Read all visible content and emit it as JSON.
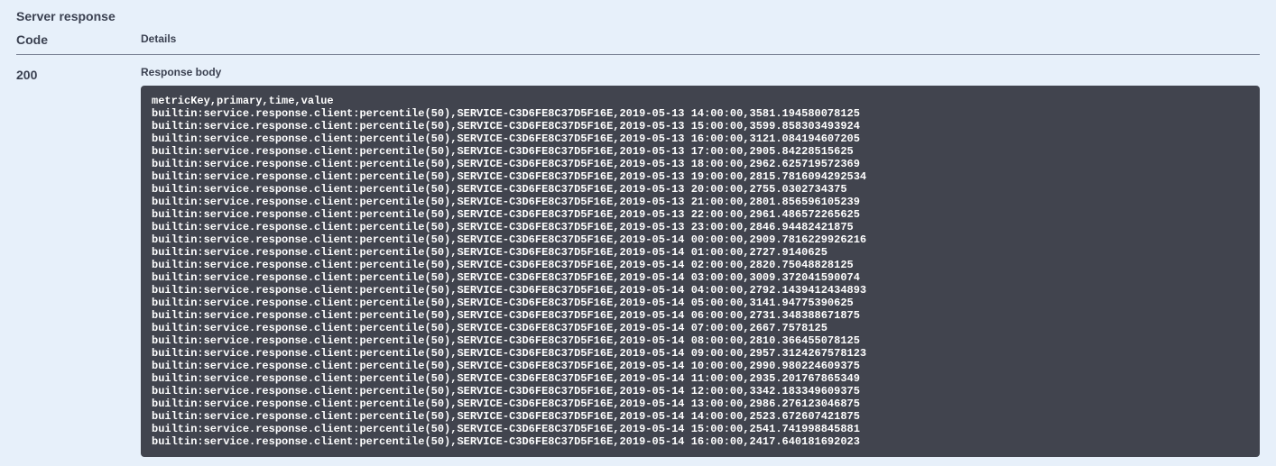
{
  "header": {
    "section_title": "Server response",
    "col_code": "Code",
    "col_details": "Details"
  },
  "row": {
    "code": "200",
    "body_label": "Response body"
  },
  "response": {
    "header_line": "metricKey,primary,time,value",
    "metric_prefix": "builtin:service.response.client:percentile(50),SERVICE-C3D6FE8C37D5F16E,",
    "rows": [
      {
        "time": "2019-05-13 14:00:00",
        "value": "3581.194580078125"
      },
      {
        "time": "2019-05-13 15:00:00",
        "value": "3599.858303493924"
      },
      {
        "time": "2019-05-13 16:00:00",
        "value": "3121.084194607205"
      },
      {
        "time": "2019-05-13 17:00:00",
        "value": "2905.84228515625"
      },
      {
        "time": "2019-05-13 18:00:00",
        "value": "2962.625719572369"
      },
      {
        "time": "2019-05-13 19:00:00",
        "value": "2815.7816094292534"
      },
      {
        "time": "2019-05-13 20:00:00",
        "value": "2755.0302734375"
      },
      {
        "time": "2019-05-13 21:00:00",
        "value": "2801.856596105239"
      },
      {
        "time": "2019-05-13 22:00:00",
        "value": "2961.486572265625"
      },
      {
        "time": "2019-05-13 23:00:00",
        "value": "2846.94482421875"
      },
      {
        "time": "2019-05-14 00:00:00",
        "value": "2909.7816229926216"
      },
      {
        "time": "2019-05-14 01:00:00",
        "value": "2727.9140625"
      },
      {
        "time": "2019-05-14 02:00:00",
        "value": "2820.75048828125"
      },
      {
        "time": "2019-05-14 03:00:00",
        "value": "3009.372041590074"
      },
      {
        "time": "2019-05-14 04:00:00",
        "value": "2792.1439412434893"
      },
      {
        "time": "2019-05-14 05:00:00",
        "value": "3141.94775390625"
      },
      {
        "time": "2019-05-14 06:00:00",
        "value": "2731.348388671875"
      },
      {
        "time": "2019-05-14 07:00:00",
        "value": "2667.7578125"
      },
      {
        "time": "2019-05-14 08:00:00",
        "value": "2810.366455078125"
      },
      {
        "time": "2019-05-14 09:00:00",
        "value": "2957.3124267578123"
      },
      {
        "time": "2019-05-14 10:00:00",
        "value": "2990.980224609375"
      },
      {
        "time": "2019-05-14 11:00:00",
        "value": "2935.201767865349"
      },
      {
        "time": "2019-05-14 12:00:00",
        "value": "3342.183349609375"
      },
      {
        "time": "2019-05-14 13:00:00",
        "value": "2986.276123046875"
      },
      {
        "time": "2019-05-14 14:00:00",
        "value": "2523.672607421875"
      },
      {
        "time": "2019-05-14 15:00:00",
        "value": "2541.741998845881"
      },
      {
        "time": "2019-05-14 16:00:00",
        "value": "2417.640181692023"
      }
    ]
  }
}
